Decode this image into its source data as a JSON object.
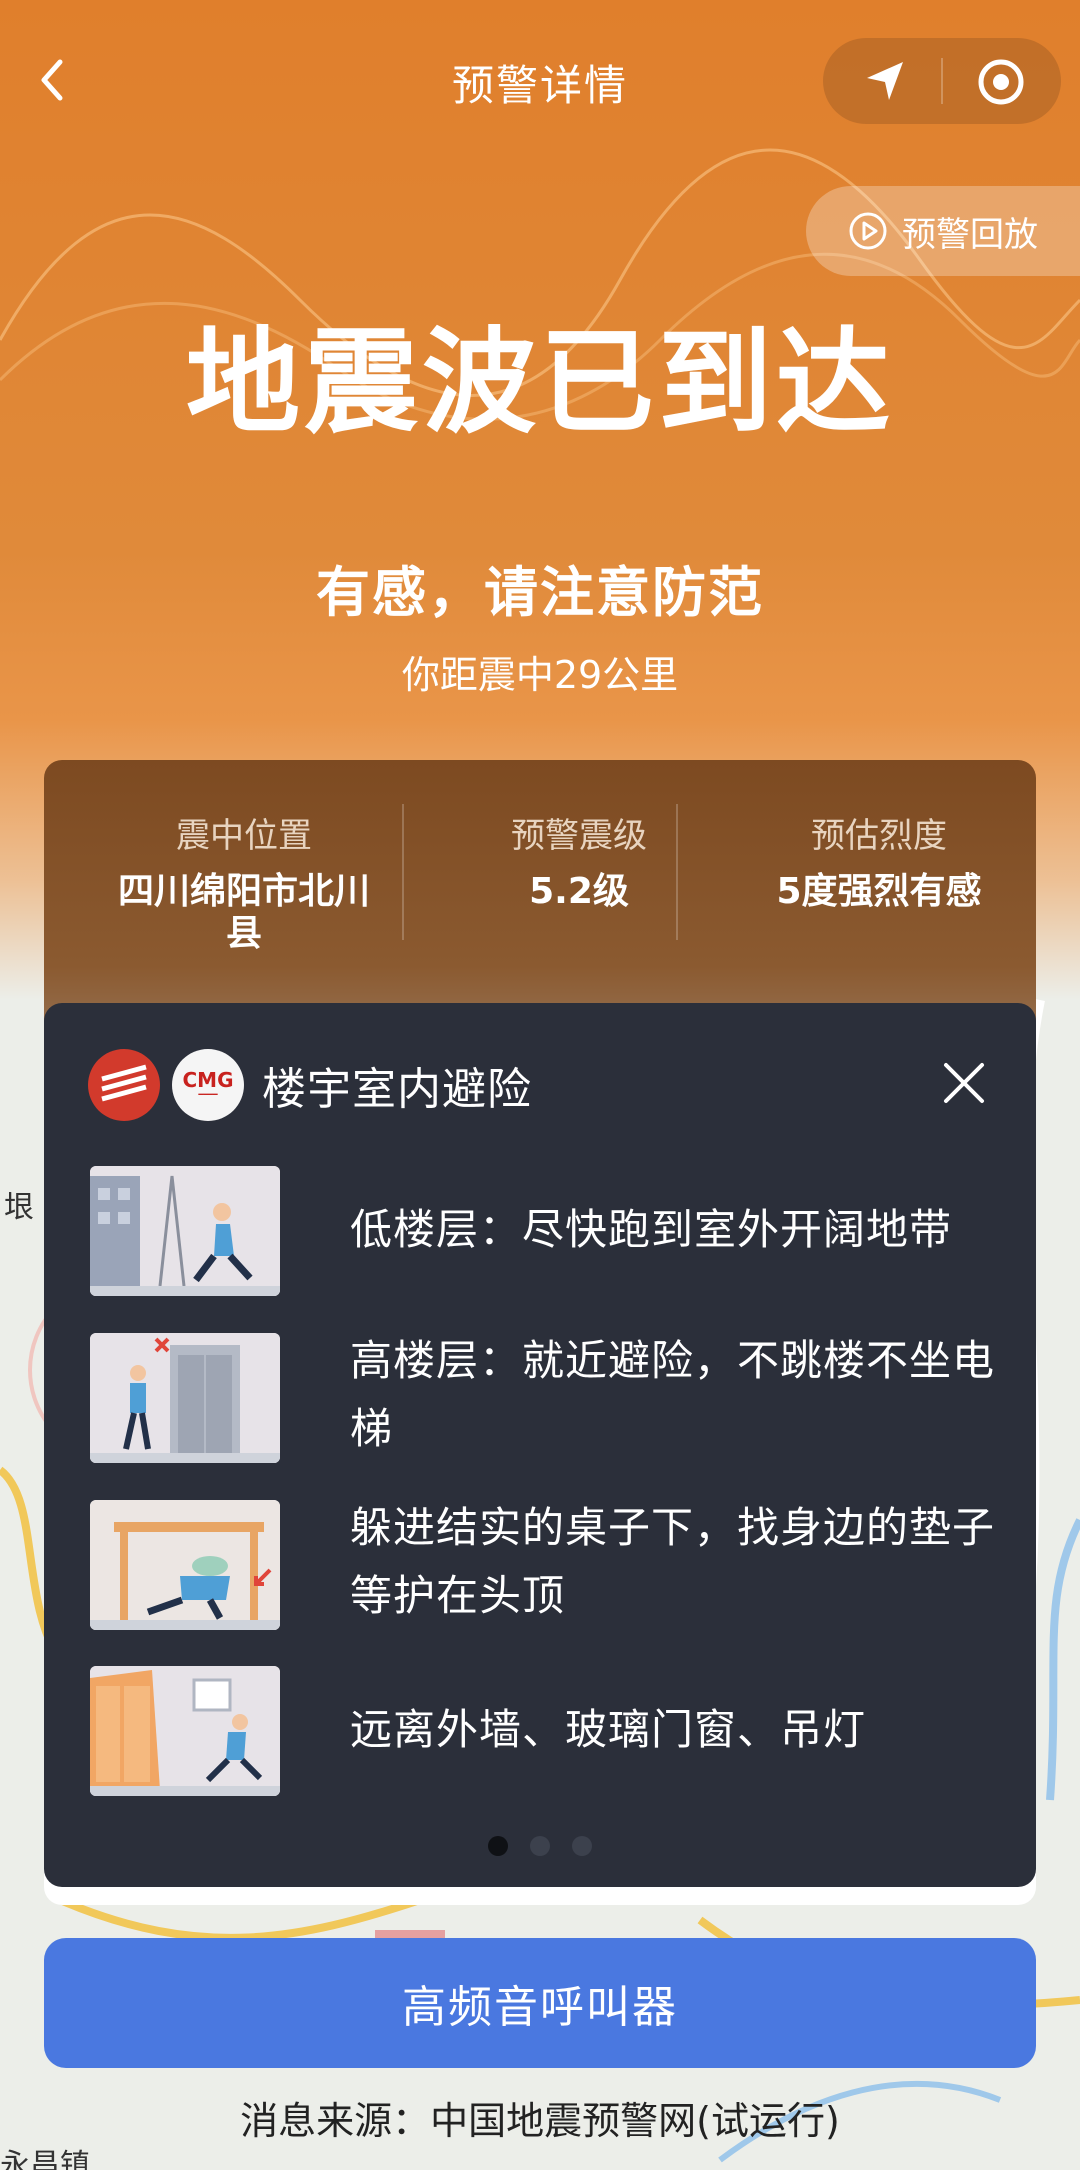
{
  "nav": {
    "title": "预警详情"
  },
  "replay_label": "预警回放",
  "headline": "地震波已到达",
  "subline": "有感，请注意防范",
  "distance": "你距震中29公里",
  "info": {
    "epicenter_label": "震中位置",
    "epicenter_value": "四川绵阳市北川县",
    "magnitude_label": "预警震级",
    "magnitude_value": "5.2级",
    "intensity_label": "预估烈度",
    "intensity_value": "5度强烈有感"
  },
  "popup": {
    "logo2_text": "CMG",
    "title": "楼宇室内避险",
    "tips": [
      {
        "text": "低楼层：尽快跑到室外开阔地带"
      },
      {
        "text": "高楼层：就近避险，不跳楼不坐电梯"
      },
      {
        "text": "躲进结实的桌子下，找身边的垫子等护在头顶"
      },
      {
        "text": "远离外墙、玻璃门窗、吊灯"
      }
    ],
    "page_count": 3,
    "active_page": 0
  },
  "cta_label": "高频音呼叫器",
  "source": "消息来源：中国地震预警网(试运行)",
  "map_labels": {
    "left_label": "垠",
    "bottom_label": "永昌镇"
  },
  "colors": {
    "hero": "#e07f2c",
    "popup_bg": "#2b2f3a",
    "cta": "#4a78e0"
  }
}
